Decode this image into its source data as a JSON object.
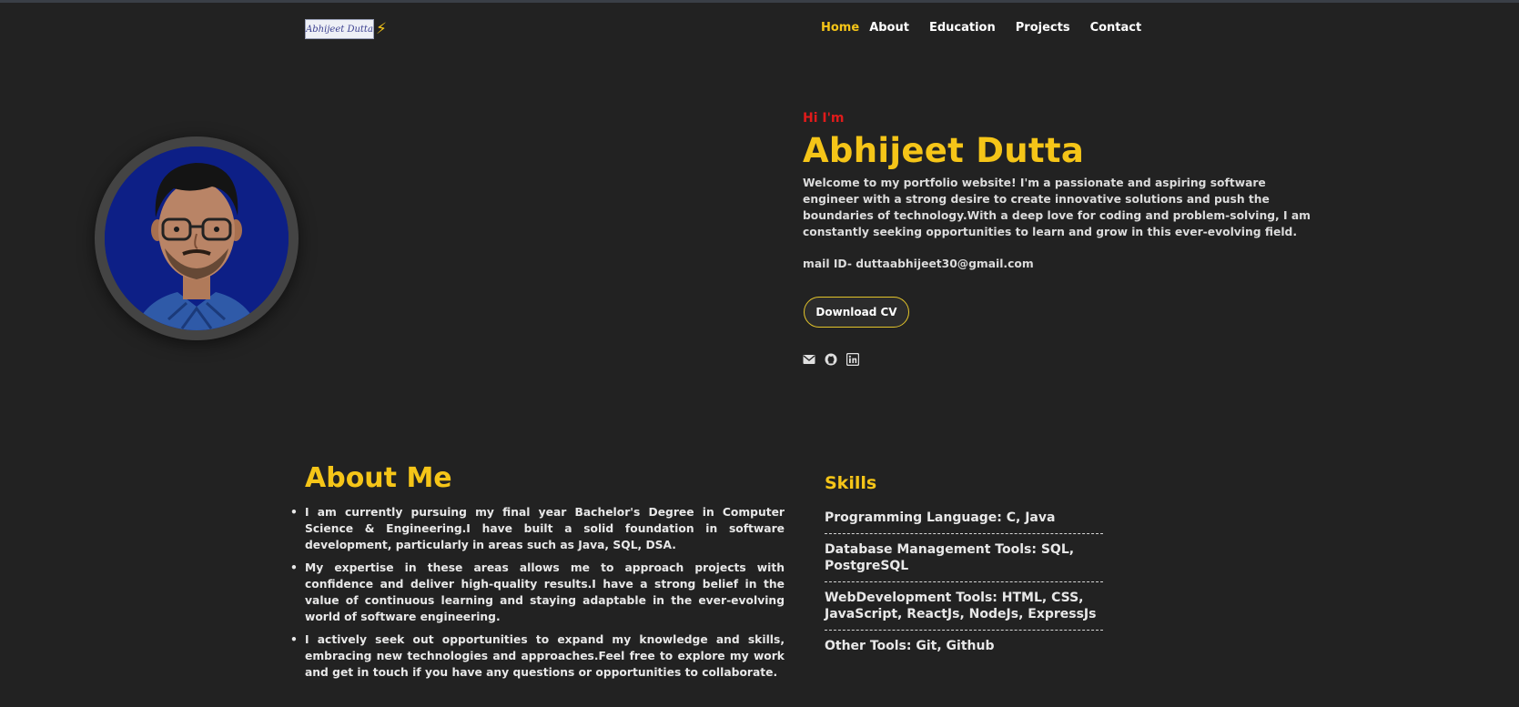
{
  "nav": {
    "logo_text": "Abhijeet Dutta",
    "logo_icon": "lightning-bolt-icon",
    "items": [
      {
        "label": "Home",
        "active": true
      },
      {
        "label": "About"
      },
      {
        "label": "Education"
      },
      {
        "label": "Projects"
      },
      {
        "label": "Contact"
      }
    ]
  },
  "hero": {
    "greeting": "Hi I'm",
    "name": "Abhijeet Dutta",
    "intro": "Welcome to my portfolio website! I'm a passionate and aspiring software engineer with a strong desire to create innovative solutions and push the boundaries of technology.With a deep love for coding and problem-solving, I am constantly seeking opportunities to learn and grow in this ever-evolving field.",
    "mail": "mail ID- duttaabhijeet30@gmail.com",
    "cv_button": "Download CV",
    "socials": [
      "envelope-icon",
      "github-icon",
      "linkedin-icon"
    ]
  },
  "about": {
    "title": "About Me",
    "points": [
      "I am currently pursuing my final year Bachelor's Degree in Computer Science & Engineering.I have built a solid foundation in software development, particularly in areas such as Java, SQL, DSA.",
      "My expertise in these areas allows me to approach projects with confidence and deliver high-quality results.I have a strong belief in the value of continuous learning and staying adaptable in the ever-evolving world of software engineering.",
      "I actively seek out opportunities to expand my knowledge and skills, embracing new technologies and approaches.Feel free to explore my work and get in touch if you have any questions or opportunities to collaborate."
    ]
  },
  "skills": {
    "title": "Skills",
    "items": [
      "Programming Language: C, Java",
      "Database Management Tools: SQL, PostgreSQL",
      "WebDevelopment Tools: HTML, CSS, JavaScript, ReactJs, NodeJs, ExpressJs",
      "Other Tools: Git, Github"
    ]
  },
  "colors": {
    "background": "#222222",
    "accent": "#f5c518",
    "greeting": "#e01b1b",
    "avatar_bg": "#0d1f86"
  }
}
